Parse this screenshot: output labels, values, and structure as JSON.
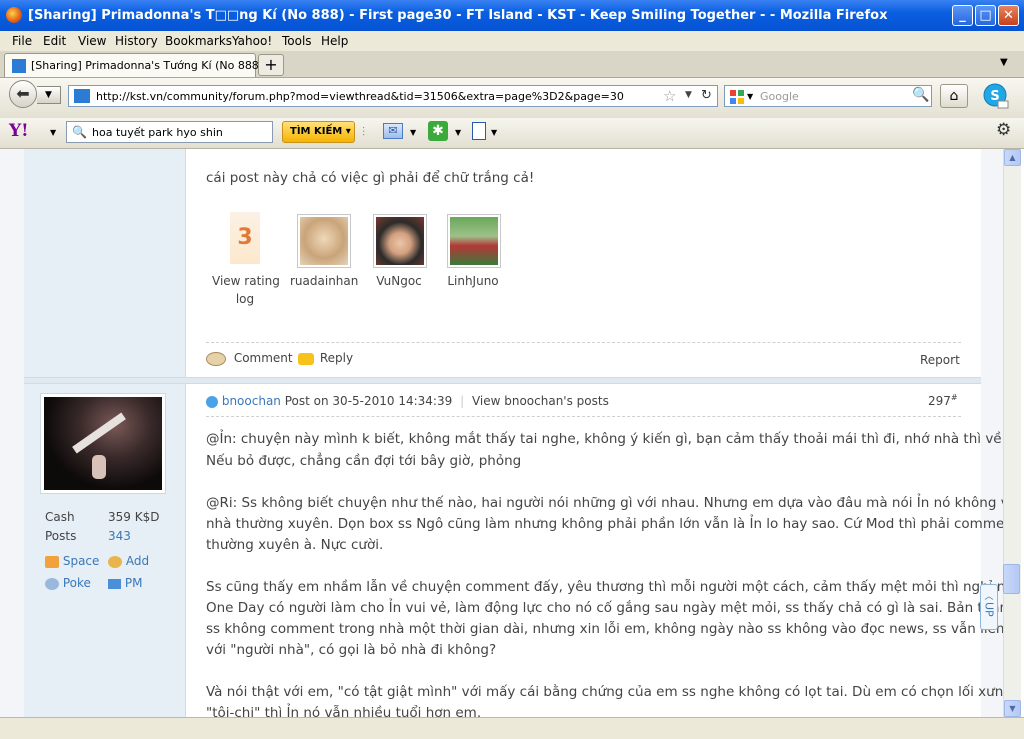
{
  "window": {
    "title": "[Sharing] Primadonna's T□□ng Kí (No 888) - First page30 - FT Island - KST - Keep Smiling Together - - Mozilla Firefox"
  },
  "menu": [
    "File",
    "Edit",
    "View",
    "History",
    "Bookmarks",
    "Yahoo!",
    "Tools",
    "Help"
  ],
  "tab": {
    "label": "[Sharing] Primadonna's Tướng Kí (No 888) - ...",
    "close": "×",
    "new_tab": "+"
  },
  "nav": {
    "url": "http://kst.vn/community/forum.php?mod=viewthread&tid=31506&extra=page%3D2&page=30",
    "search_placeholder": "Google"
  },
  "yahoo": {
    "logo": "Y!",
    "search_value": "hoa tuyết park hyo shin",
    "search_button": "TÌM KIẾM ▾"
  },
  "post1": {
    "text": "cái post này chả có việc gì phải để chữ trắng cả!",
    "rating": {
      "count": "3",
      "link_line1": "View rating",
      "link_line2": "log"
    },
    "raters": [
      "ruadainhan",
      "VuNgoc",
      "LinhJuno"
    ],
    "actions": {
      "comment": "Comment",
      "reply": "Reply",
      "report": "Report"
    }
  },
  "post2": {
    "author": "bnoochan",
    "posted": "Post on 30-5-2010 14:34:39",
    "view_posts": "View bnoochan's posts",
    "floor": "297",
    "floor_sup": "#",
    "stats": [
      {
        "label": "Cash",
        "value": "359 K$D"
      },
      {
        "label": "Posts",
        "value": "343"
      }
    ],
    "profile_links": [
      "Space",
      "Add",
      "Poke",
      "PM"
    ],
    "paragraphs": [
      [
        "@Ỉn: chuyện này mình k biết, không mắt thấy tai nghe, không ý kiến gì, bạn cảm thấy thoải mái thì đi, nhớ nhà thì về.",
        "Nếu bỏ được, chẳng cần đợi tới bây giờ, phỏng"
      ],
      [
        "@Ri: Ss không biết chuyện như thế nào, hai người nói những gì với nhau. Nhưng em dựa vào đâu mà nói Ỉn nó không vào",
        "nhà thường xuyên. Dọn box ss Ngô cũng làm nhưng không phải phần lớn vẫn là Ỉn lo hay sao. Cứ Mod thì phải comment",
        "thường xuyên à. Nực cười."
      ],
      [
        "Ss cũng thấy em nhầm lẫn về chuyện comment đấy, yêu thương thì mỗi người một cách, cảm thấy mệt mỏi thì nghỉ ngơi,",
        "One Day có người làm cho Ỉn vui vẻ, làm động lực cho nó cố gắng sau ngày mệt mỏi, ss thấy chả có gì là sai. Bản thân ss,",
        "ss không comment trong nhà một thời gian dài, nhưng xin lỗi em, không ngày nào ss không vào đọc news, ss vẫn liên lạc",
        "với \"người nhà\", có gọi là bỏ nhà đi không?"
      ],
      [
        "Và nói thật với em, \"có tật giật mình\" với mấy cái bằng chứng của em ss nghe không có lọt tai. Dù em có chọn lối xưng hô",
        "\"tôi-chị\" thì Ỉn nó vẫn nhiều tuổi hơn em."
      ]
    ]
  },
  "up_button": "UP"
}
